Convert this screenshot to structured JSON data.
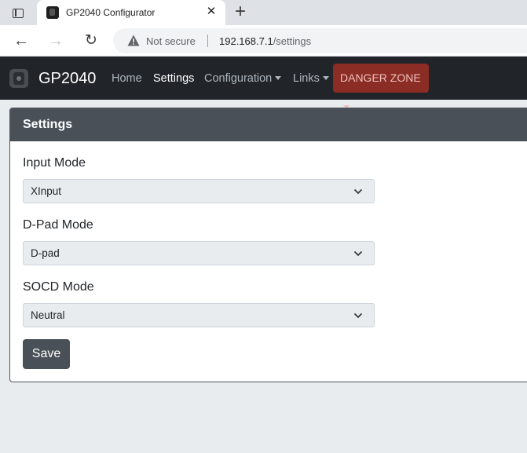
{
  "browser": {
    "tab_title": "GP2040 Configurator",
    "tab_close": "✕",
    "new_tab": "+",
    "back": "←",
    "forward": "→",
    "reload": "↻",
    "security_label": "Not secure",
    "url_host": "192.168.7.1",
    "url_path": "/settings"
  },
  "navbar": {
    "brand": "GP2040",
    "links": {
      "home": "Home",
      "settings": "Settings",
      "configuration": "Configuration",
      "links": "Links",
      "danger_zone": "DANGER ZONE"
    }
  },
  "card": {
    "title": "Settings",
    "fields": [
      {
        "label": "Input Mode",
        "value": "XInput"
      },
      {
        "label": "D-Pad Mode",
        "value": "D-pad"
      },
      {
        "label": "SOCD Mode",
        "value": "Neutral"
      }
    ],
    "save_label": "Save"
  },
  "colors": {
    "navbar_bg": "#212529",
    "card_header_bg": "#495057",
    "danger_bg": "#8b2c25",
    "page_bg": "#e9ecef"
  }
}
